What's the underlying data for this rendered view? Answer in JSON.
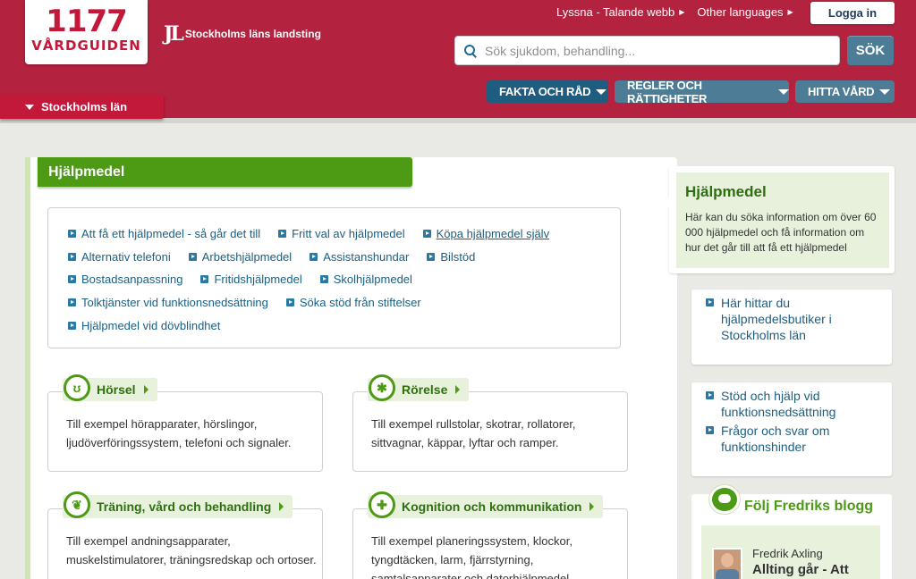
{
  "header": {
    "logo_number": "1177",
    "logo_name": "VÅRDGUIDEN",
    "org_mark": "JL",
    "org_name": "Stockholms läns landsting",
    "listen_link": "Lyssna - Talande webb",
    "languages_link": "Other languages",
    "login_label": "Logga in",
    "search_placeholder": "Sök sjukdom, behandling...",
    "search_button": "SÖK",
    "nav": {
      "fakta": "FAKTA OCH RÅD",
      "regler": "REGLER OCH RÄTTIGHETER",
      "hitta": "HITTA VÅRD"
    },
    "region": "Stockholms län"
  },
  "main": {
    "title": "Hjälpmedel",
    "links": [
      [
        "Att få ett hjälpmedel - så går det till",
        "Fritt val av hjälpmedel",
        "Köpa hjälpmedel själv"
      ],
      [
        "Alternativ telefoni",
        "Arbetshjälpmedel",
        "Assistanshundar",
        "Bilstöd"
      ],
      [
        "Bostadsanpassning",
        "Fritidshjälpmedel",
        "Skolhjälpmedel"
      ],
      [
        "Tolktjänster vid funktionsnedsättning",
        "Söka stöd från stiftelser"
      ],
      [
        "Hjälpmedel vid dövblindhet"
      ]
    ],
    "cards": {
      "horsel": {
        "title": "Hörsel",
        "text": "Till exempel hörapparater, hörslingor, ljudöverföringssystem, telefoni och signaler."
      },
      "rorelse": {
        "title": "Rörelse",
        "text": "Till exempel rullstolar, skotrar, rollatorer, sittvagnar, käppar, lyftar och ramper."
      },
      "traning": {
        "title": "Träning, vård och behandling",
        "text": "Till exempel andningsapparater, muskelstimulatorer, träningsredskap och ortoser."
      },
      "kognition": {
        "title": "Kognition och kommunikation",
        "text": "Till exempel planeringssystem, klockor, tyngdtäcken, larm, fjärrstyrning, samtalsapparater och datorhjälpmedel."
      }
    }
  },
  "sidebar": {
    "info_title": "Hjälpmedel",
    "info_text": "Här kan du söka information om över 60 000 hjälpmedel och få information om hur det går till att få ett hjälpmedel",
    "box1": [
      "Här hittar du hjälpmedelsbutiker i Stockholms län"
    ],
    "box2": [
      "Stöd och hjälp vid funktionsnedsättning",
      "Frågor och svar om funktionshinder"
    ],
    "blog_title": "Följ Fredriks blogg",
    "blog_author": "Fredrik Axling",
    "blog_post": "Allting går - Att"
  }
}
